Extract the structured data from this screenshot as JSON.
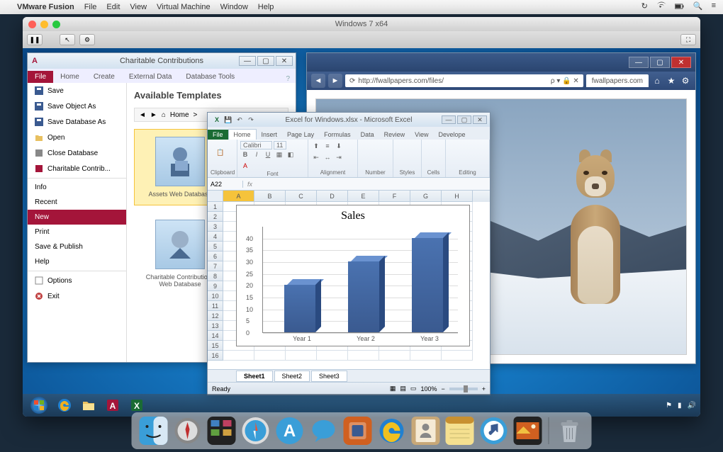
{
  "mac_menubar": {
    "app": "VMware Fusion",
    "items": [
      "File",
      "Edit",
      "View",
      "Virtual Machine",
      "Window",
      "Help"
    ]
  },
  "vm_window": {
    "title": "Windows 7 x64"
  },
  "access": {
    "title": "Charitable Contributions",
    "tabs": [
      "File",
      "Home",
      "Create",
      "External Data",
      "Database Tools"
    ],
    "sidebar_top": [
      {
        "icon": "save",
        "label": "Save"
      },
      {
        "icon": "save",
        "label": "Save Object As"
      },
      {
        "icon": "save",
        "label": "Save Database As"
      },
      {
        "icon": "open",
        "label": "Open"
      },
      {
        "icon": "close",
        "label": "Close Database"
      },
      {
        "icon": "db",
        "label": "Charitable Contrib..."
      }
    ],
    "sidebar_mid": [
      {
        "label": "Info"
      },
      {
        "label": "Recent"
      },
      {
        "label": "New",
        "selected": true
      },
      {
        "label": "Print"
      },
      {
        "label": "Save & Publish"
      },
      {
        "label": "Help"
      }
    ],
    "sidebar_bot": [
      {
        "icon": "options",
        "label": "Options"
      },
      {
        "icon": "exit",
        "label": "Exit"
      }
    ],
    "main_heading": "Available Templates",
    "breadcrumb": [
      "Home",
      ">"
    ],
    "templates": [
      {
        "label": "Assets Web Database",
        "selected": true
      },
      {
        "label": "Charitable Contributions Web Database",
        "selected": false
      }
    ]
  },
  "ie": {
    "url": "http://fwallpapers.com/files/",
    "url_suffix": "ρ ▾ 🔒 ✕",
    "tab": "fwallpapers.com"
  },
  "excel": {
    "title": "Excel for Windows.xlsx - Microsoft Excel",
    "tabs": [
      "File",
      "Home",
      "Insert",
      "Page Lay",
      "Formulas",
      "Data",
      "Review",
      "View",
      "Develope"
    ],
    "ribbon_groups": [
      "Clipboard",
      "Font",
      "Alignment",
      "Number",
      "Styles",
      "Cells",
      "Editing"
    ],
    "font_name": "Calibri",
    "font_size": "11",
    "namebox": "A22",
    "cols": [
      "A",
      "B",
      "C",
      "D",
      "E",
      "F",
      "G",
      "H"
    ],
    "sheets": [
      "Sheet1",
      "Sheet2",
      "Sheet3"
    ],
    "status": "Ready",
    "zoom": "100%"
  },
  "chart_data": {
    "type": "bar",
    "title": "Sales",
    "categories": [
      "Year 1",
      "Year 2",
      "Year 3"
    ],
    "values": [
      20,
      30,
      40
    ],
    "ylim": [
      0,
      45
    ],
    "yticks": [
      0,
      5,
      10,
      15,
      20,
      25,
      30,
      35,
      40
    ],
    "xlabel": "",
    "ylabel": ""
  },
  "win7_taskbar_icons": [
    "start",
    "ie",
    "explorer",
    "access",
    "excel"
  ]
}
